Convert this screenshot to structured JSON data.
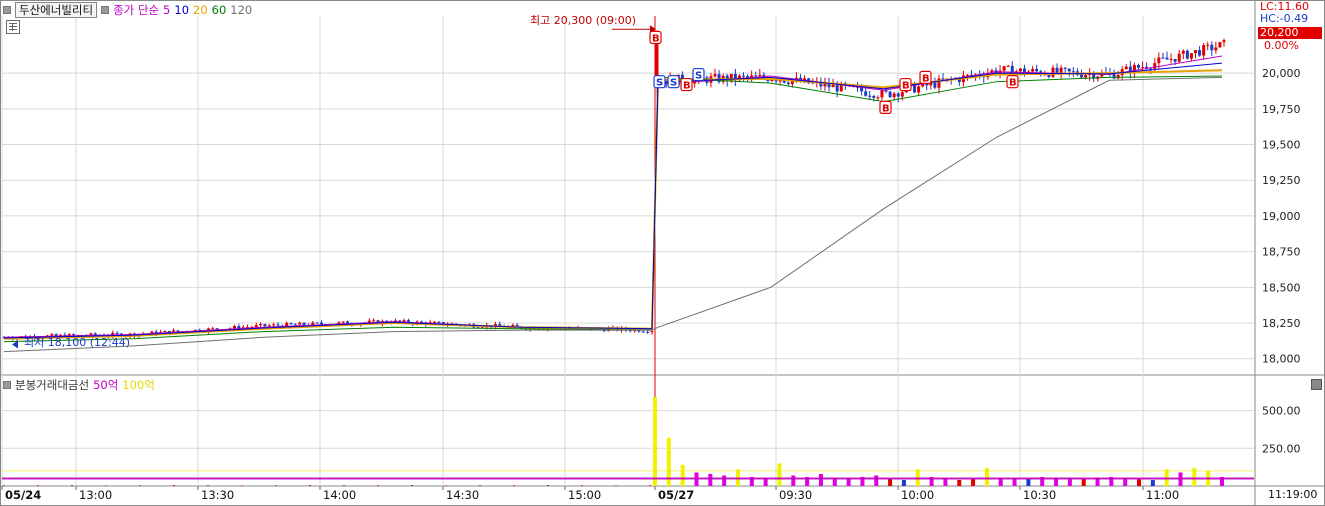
{
  "stock_name": "두산에너빌리티",
  "ma_legend": {
    "label": "종가 단순",
    "periods": [
      "5",
      "10",
      "20",
      "60",
      "120"
    ],
    "colors": [
      "#c000c0",
      "#0000c8",
      "#e8a000",
      "#008000",
      "#707070"
    ]
  },
  "volume_legend": {
    "label": "분봉거래대금선",
    "lines": [
      "50억",
      "100억"
    ],
    "colors": [
      "#c000c0",
      "#e8e800"
    ]
  },
  "right_panel": {
    "lc": "LC:11.60",
    "hc": "HC:-0.49",
    "current_price": "20,200",
    "change_pct": "0.00%"
  },
  "annotations": {
    "high": "최고 20,300 (09:00)",
    "low": "최저 18,100 (12:44)"
  },
  "x_tick_labels": [
    "05/24",
    "13:00",
    "13:30",
    "14:00",
    "14:30",
    "15:00",
    "05/27",
    "09:30",
    "10:00",
    "10:30",
    "11:00"
  ],
  "time_now": "11:19:00",
  "colors": {
    "up": "#e00000",
    "down": "#1a3cc8",
    "grid": "#d8d8d8",
    "vol_yellow": "#f2f200",
    "vol_magenta": "#e000e0"
  },
  "chart_data": [
    {
      "type": "candlestick",
      "title": "두산에너빌리티",
      "y_ticks": [
        18000,
        18250,
        18500,
        18750,
        19000,
        19250,
        19500,
        19750,
        20000
      ],
      "y_tick_labels": [
        "18,000",
        "18,250",
        "18,500",
        "18,750",
        "19,000",
        "19,250",
        "19,500",
        "19,750",
        "20,000"
      ],
      "ylim": [
        17900,
        20400
      ],
      "x": [
        "05/24",
        "13:00",
        "13:30",
        "14:00",
        "14:30",
        "15:00",
        "05/27",
        "09:30",
        "10:00",
        "10:30",
        "11:00",
        "11:19"
      ],
      "close_series": [
        18150,
        18170,
        18230,
        18260,
        18220,
        18200,
        19950,
        19970,
        19850,
        20020,
        19990,
        20200
      ],
      "ma5": [
        18150,
        18170,
        18220,
        18260,
        18220,
        18210,
        19920,
        19980,
        19880,
        20010,
        19990,
        20120
      ],
      "ma20": [
        18140,
        18160,
        18210,
        18250,
        18220,
        18210,
        19950,
        19960,
        19900,
        19990,
        20000,
        20020
      ],
      "ma60": [
        18120,
        18140,
        18190,
        18220,
        18210,
        18200,
        19970,
        19930,
        19800,
        19940,
        19970,
        19980
      ],
      "ma120": [
        18050,
        18090,
        18150,
        18190,
        18200,
        18200,
        18220,
        18500,
        19050,
        19550,
        19950,
        19970
      ],
      "high": {
        "value": 20300,
        "time": "09:00"
      },
      "low": {
        "value": 18100,
        "time": "12:44"
      },
      "markers": [
        "B",
        "S",
        "S",
        "B",
        "S",
        "B",
        "B",
        "B",
        "B"
      ]
    },
    {
      "type": "bar",
      "title": "분봉거래대금선",
      "y_tick_labels": [
        "500.00",
        "250.00"
      ],
      "ylim": [
        0,
        650
      ],
      "reference_lines": [
        {
          "name": "50억",
          "value": 50
        },
        {
          "name": "100억",
          "value": 100
        }
      ],
      "values_prev_day": [
        5,
        5,
        6,
        4,
        5,
        6,
        5,
        4,
        5,
        6,
        5,
        5,
        6,
        4,
        5,
        5,
        6,
        5,
        4,
        5
      ],
      "values_today": [
        590,
        320,
        140,
        90,
        80,
        70,
        110,
        60,
        55,
        150,
        70,
        60,
        80,
        55,
        50,
        60,
        70,
        45,
        40,
        110,
        60,
        50,
        40,
        45,
        120,
        55,
        50,
        45,
        60,
        55,
        50,
        45,
        55,
        60,
        50,
        45,
        40,
        110,
        90,
        120,
        100,
        60
      ]
    }
  ]
}
